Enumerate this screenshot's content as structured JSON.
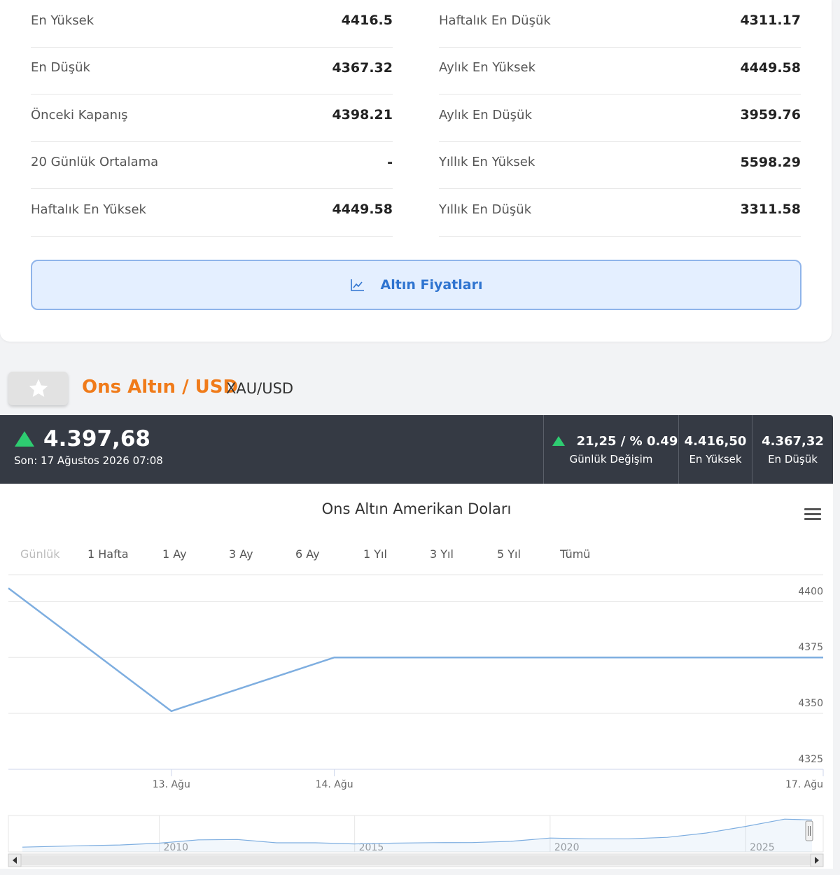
{
  "stats": {
    "left": [
      {
        "label": "En Yüksek",
        "value": "4416.5"
      },
      {
        "label": "En Düşük",
        "value": "4367.32"
      },
      {
        "label": "Önceki Kapanış",
        "value": "4398.21"
      },
      {
        "label": "20 Günlük Ortalama",
        "value": "-"
      },
      {
        "label": "Haftalık En Yüksek",
        "value": "4449.58"
      }
    ],
    "right": [
      {
        "label": "Haftalık En Düşük",
        "value": "4311.17"
      },
      {
        "label": "Aylık En Yüksek",
        "value": "4449.58"
      },
      {
        "label": "Aylık En Düşük",
        "value": "3959.76"
      },
      {
        "label": "Yıllık En Yüksek",
        "value": "5598.29"
      },
      {
        "label": "Yıllık En Düşük",
        "value": "3311.58"
      }
    ]
  },
  "gold_button": {
    "label": "Altın Fiyatları",
    "icon": "line-chart-icon"
  },
  "asset": {
    "title": "Ons Altın / USD",
    "code": "XAU/USD",
    "favorite_icon": "star-icon"
  },
  "price": {
    "value": "4.397,68",
    "updated": "Son: 17 Ağustos 2026 07:08",
    "trend_icon": "up-triangle-icon",
    "daily_change": "21,25 / % 0.49",
    "daily_change_label": "Günlük Değişim",
    "high": "4.416,50",
    "high_label": "En Yüksek",
    "low": "4.367,32",
    "low_label": "En Düşük"
  },
  "chart": {
    "title": "Ons Altın Amerikan Doları",
    "ranges": [
      "Günlük",
      "1 Hafta",
      "1 Ay",
      "3 Ay",
      "6 Ay",
      "1 Yıl",
      "3 Yıl",
      "5 Yıl",
      "Tümü"
    ],
    "selected_range": "Günlük"
  },
  "colors": {
    "accent": "#f07b1a",
    "link": "#2f74d0",
    "line": "#7eaee0",
    "up": "#2ecc71",
    "bar": "#353a44"
  },
  "chart_data": {
    "type": "line",
    "x": [
      "2026-08-12",
      "2026-08-13",
      "2026-08-14",
      "2026-08-17"
    ],
    "series": [
      {
        "values": [
          4406,
          4351,
          4375,
          4375
        ]
      }
    ],
    "x_ticks": [
      "13. Ağu",
      "14. Ağu",
      "17. Ağu"
    ],
    "y_ticks": [
      4325,
      4350,
      4375,
      4400
    ],
    "ylim": [
      4325,
      4412
    ],
    "grid": true,
    "navigator": {
      "x_ticks": [
        "2010",
        "2015",
        "2020",
        "2025"
      ],
      "x_range": [
        2006.5,
        2026.7
      ],
      "points": [
        [
          2006.5,
          650
        ],
        [
          2008,
          850
        ],
        [
          2009,
          950
        ],
        [
          2010,
          1200
        ],
        [
          2011,
          1650
        ],
        [
          2012,
          1700
        ],
        [
          2013,
          1250
        ],
        [
          2014,
          1250
        ],
        [
          2015,
          1100
        ],
        [
          2016,
          1200
        ],
        [
          2017,
          1270
        ],
        [
          2018,
          1280
        ],
        [
          2019,
          1450
        ],
        [
          2020,
          1900
        ],
        [
          2021,
          1800
        ],
        [
          2022,
          1800
        ],
        [
          2023,
          2000
        ],
        [
          2024,
          2600
        ],
        [
          2025,
          3500
        ],
        [
          2026,
          4500
        ],
        [
          2026.7,
          4397
        ]
      ],
      "ylim": [
        0,
        5000
      ]
    }
  }
}
